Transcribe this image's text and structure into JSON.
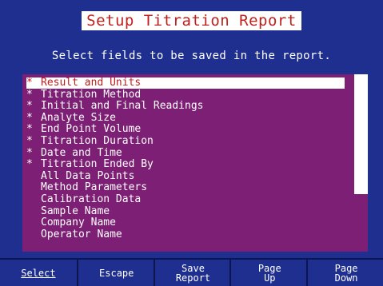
{
  "title": "Setup Titration Report",
  "instruction": "Select fields to be saved in the report.",
  "check_mark": "*",
  "items": [
    {
      "label": "Result and Units",
      "checked": true,
      "selected": true
    },
    {
      "label": "Titration Method",
      "checked": true,
      "selected": false
    },
    {
      "label": "Initial and Final Readings",
      "checked": true,
      "selected": false
    },
    {
      "label": "Analyte Size",
      "checked": true,
      "selected": false
    },
    {
      "label": "End Point Volume",
      "checked": true,
      "selected": false
    },
    {
      "label": "Titration Duration",
      "checked": true,
      "selected": false
    },
    {
      "label": "Date and Time",
      "checked": true,
      "selected": false
    },
    {
      "label": "Titration Ended By",
      "checked": true,
      "selected": false
    },
    {
      "label": "All Data Points",
      "checked": false,
      "selected": false
    },
    {
      "label": "Method Parameters",
      "checked": false,
      "selected": false
    },
    {
      "label": "Calibration Data",
      "checked": false,
      "selected": false
    },
    {
      "label": "Sample Name",
      "checked": false,
      "selected": false
    },
    {
      "label": "Company Name",
      "checked": false,
      "selected": false
    },
    {
      "label": "Operator Name",
      "checked": false,
      "selected": false
    }
  ],
  "softkeys": [
    {
      "line1": "Select",
      "line2": "",
      "underline": true
    },
    {
      "line1": "Escape",
      "line2": "",
      "underline": false
    },
    {
      "line1": "Save",
      "line2": "Report",
      "underline": false
    },
    {
      "line1": "Page",
      "line2": "Up",
      "underline": false
    },
    {
      "line1": "Page",
      "line2": "Down",
      "underline": false
    }
  ],
  "colors": {
    "background": "#1f2f8f",
    "list_background": "#7d1f74",
    "title_text": "#c0201c",
    "highlight": "#ffffff"
  }
}
